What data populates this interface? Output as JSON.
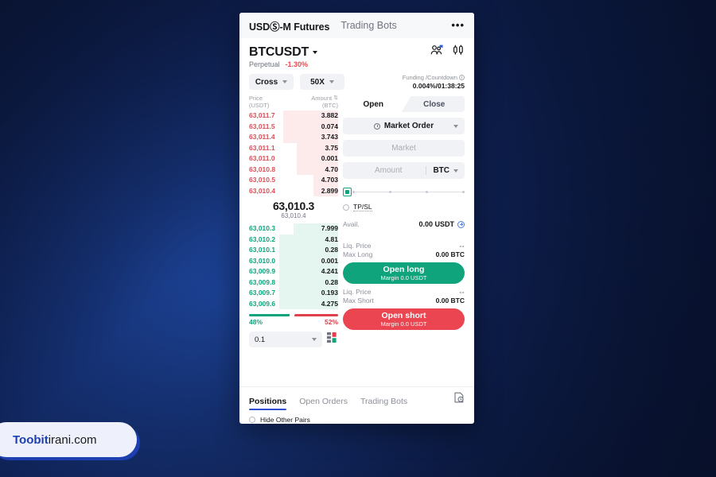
{
  "topnav": {
    "primary_tab": "USDⓈ-M Futures",
    "secondary_tab": "Trading Bots",
    "more": "•••"
  },
  "symbol": {
    "name": "BTCUSDT",
    "type": "Perpetual",
    "change": "-1.30%",
    "change_color": "#e8484f"
  },
  "controls": {
    "margin_mode": "Cross",
    "leverage": "50X",
    "funding_label": "Funding /Countdown",
    "funding_value": "0.004%/01:38:25"
  },
  "orderbook": {
    "col_price": "Price",
    "col_price_unit": "(USDT)",
    "col_amount": "Amount",
    "col_amount_unit": "(BTC)",
    "asks": [
      {
        "price": "63,011.7",
        "amount": "3.882",
        "depth": 62
      },
      {
        "price": "63,011.5",
        "amount": "0.074",
        "depth": 62
      },
      {
        "price": "63,011.4",
        "amount": "3.743",
        "depth": 62
      },
      {
        "price": "63,011.1",
        "amount": "3.75",
        "depth": 46
      },
      {
        "price": "63,011.0",
        "amount": "0.001",
        "depth": 46
      },
      {
        "price": "63,010.8",
        "amount": "4.70",
        "depth": 46
      },
      {
        "price": "63,010.5",
        "amount": "4.703",
        "depth": 28
      },
      {
        "price": "63,010.4",
        "amount": "2.899",
        "depth": 28
      }
    ],
    "mid_price": "63,010.3",
    "mid_sub": "63,010.4",
    "bids": [
      {
        "price": "63,010.3",
        "amount": "7.999",
        "depth": 50
      },
      {
        "price": "63,010.2",
        "amount": "4.81",
        "depth": 66
      },
      {
        "price": "63,010.1",
        "amount": "0.28",
        "depth": 66
      },
      {
        "price": "63,010.0",
        "amount": "0.001",
        "depth": 66
      },
      {
        "price": "63,009.9",
        "amount": "4.241",
        "depth": 66
      },
      {
        "price": "63,009.8",
        "amount": "0.28",
        "depth": 66
      },
      {
        "price": "63,009.7",
        "amount": "0.193",
        "depth": 66
      },
      {
        "price": "63,009.6",
        "amount": "4.275",
        "depth": 66
      }
    ],
    "buy_pct": "48%",
    "sell_pct": "52%",
    "buy_ratio": 48,
    "sell_ratio": 52,
    "grouping": "0.1",
    "colors": {
      "ask": "#d9525a",
      "bid": "#12a47d",
      "ask_depth": "#fdebec",
      "bid_depth": "#e5f6f1"
    }
  },
  "trade": {
    "tab_open": "Open",
    "tab_close": "Close",
    "order_type": "Market Order",
    "price_field": "Market",
    "amount_placeholder": "Amount",
    "amount_unit": "BTC",
    "tpsl_label": "TP/SL",
    "avail_label": "Avail.",
    "avail_value": "0.00 USDT",
    "long": {
      "liq_label": "Liq. Price",
      "liq_value": "--",
      "max_label": "Max Long",
      "max_value": "0.00 BTC",
      "button": "Open long",
      "button_sub_label": "Margin",
      "button_sub_value": "0.0 USDT",
      "color": "#0fa47c"
    },
    "short": {
      "liq_label": "Liq. Price",
      "liq_value": "--",
      "max_label": "Max Short",
      "max_value": "0.00 BTC",
      "button": "Open short",
      "button_sub_label": "Margin",
      "button_sub_value": "0.0 USDT",
      "color": "#ea4550"
    }
  },
  "bottom": {
    "tabs": [
      {
        "label": "Positions",
        "active": true
      },
      {
        "label": "Open Orders",
        "active": false
      },
      {
        "label": "Trading Bots",
        "active": false
      }
    ],
    "hide_other_pairs": "Hide Other Pairs"
  },
  "watermark": {
    "bold": "Toobit",
    "rest": "irani.com",
    "accent": "#1d3fb0"
  }
}
